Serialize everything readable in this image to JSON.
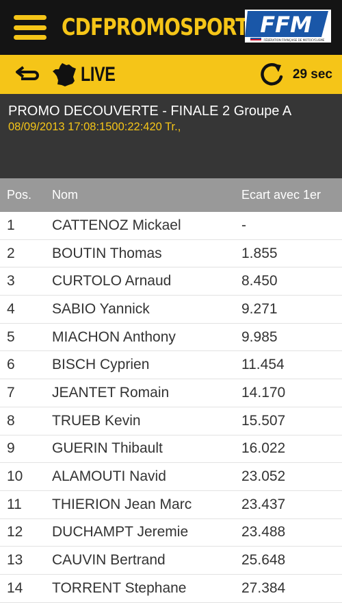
{
  "header": {
    "brand": "CDFPROMOSPORT",
    "logo_text": "FFM",
    "logo_subtitle": "FÉDÉRATION FRANÇAISE DE MOTOCYCLISME"
  },
  "livebar": {
    "live_label": "LIVE",
    "refresh_timer": "29 sec"
  },
  "event": {
    "title": "PROMO DECOUVERTE - FINALE 2 Groupe A",
    "info": "08/09/2013 17:08:1500:22:420 Tr.,"
  },
  "table": {
    "headers": {
      "pos": "Pos.",
      "name": "Nom",
      "gap": "Ecart avec 1er"
    },
    "rows": [
      {
        "pos": "1",
        "name": "CATTENOZ Mickael",
        "gap": "-"
      },
      {
        "pos": "2",
        "name": "BOUTIN Thomas",
        "gap": "1.855"
      },
      {
        "pos": "3",
        "name": "CURTOLO Arnaud",
        "gap": "8.450"
      },
      {
        "pos": "4",
        "name": "SABIO Yannick",
        "gap": "9.271"
      },
      {
        "pos": "5",
        "name": "MIACHON Anthony",
        "gap": "9.985"
      },
      {
        "pos": "6",
        "name": "BISCH Cyprien",
        "gap": "11.454"
      },
      {
        "pos": "7",
        "name": "JEANTET Romain",
        "gap": "14.170"
      },
      {
        "pos": "8",
        "name": "TRUEB Kevin",
        "gap": "15.507"
      },
      {
        "pos": "9",
        "name": "GUERIN Thibault",
        "gap": "16.022"
      },
      {
        "pos": "10",
        "name": "ALAMOUTI Navid",
        "gap": "23.052"
      },
      {
        "pos": "11",
        "name": "THIERION Jean Marc",
        "gap": "23.437"
      },
      {
        "pos": "12",
        "name": "DUCHAMPT Jeremie",
        "gap": "23.488"
      },
      {
        "pos": "13",
        "name": "CAUVIN Bertrand",
        "gap": "25.648"
      },
      {
        "pos": "14",
        "name": "TORRENT Stephane",
        "gap": "27.384"
      }
    ]
  },
  "colors": {
    "accent": "#f5c518",
    "header_bg": "#141414",
    "event_bg": "#363636",
    "table_head_bg": "#999999",
    "logo_blue": "#1a57a8"
  },
  "icons": {
    "menu": "hamburger-menu-icon",
    "back": "back-arrow-icon",
    "region": "france-map-icon",
    "refresh": "refresh-icon"
  }
}
